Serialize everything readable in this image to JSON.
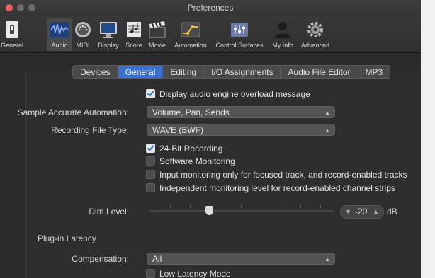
{
  "window": {
    "title": "Preferences"
  },
  "toolbar": {
    "items": [
      {
        "label": "General",
        "icon": "general-switch-icon"
      },
      {
        "label": "Audio",
        "icon": "audio-waveform-icon"
      },
      {
        "label": "MIDI",
        "icon": "midi-connector-icon"
      },
      {
        "label": "Display",
        "icon": "display-monitor-icon"
      },
      {
        "label": "Score",
        "icon": "score-notes-icon"
      },
      {
        "label": "Movie",
        "icon": "movie-clapper-icon"
      },
      {
        "label": "Automation",
        "icon": "automation-curve-icon"
      },
      {
        "label": "Control Surfaces",
        "icon": "control-surfaces-icon"
      },
      {
        "label": "My Info",
        "icon": "user-silhouette-icon"
      },
      {
        "label": "Advanced",
        "icon": "gear-icon"
      }
    ],
    "active": "Audio"
  },
  "tabs": [
    {
      "label": "Devices"
    },
    {
      "label": "General",
      "active": true
    },
    {
      "label": "Editing"
    },
    {
      "label": "I/O Assignments"
    },
    {
      "label": "Audio File Editor"
    },
    {
      "label": "MP3"
    }
  ],
  "general": {
    "overload_message": {
      "label": "Display audio engine overload message",
      "checked": true
    },
    "sample_accurate": {
      "label": "Sample Accurate Automation:",
      "value": "Volume, Pan, Sends"
    },
    "recording_file_type": {
      "label": "Recording File Type:",
      "value": "WAVE (BWF)"
    },
    "checks": [
      {
        "label": "24-Bit Recording",
        "checked": true
      },
      {
        "label": "Software Monitoring",
        "checked": false
      },
      {
        "label": "Input monitoring only for focused track, and record-enabled tracks",
        "checked": false
      },
      {
        "label": "Independent monitoring level for record-enabled channel strips",
        "checked": false
      }
    ],
    "dim_level": {
      "label": "Dim Level:",
      "value": "-20",
      "unit": "dB"
    }
  },
  "plugin_latency": {
    "section_title": "Plug-in Latency",
    "compensation": {
      "label": "Compensation:",
      "value": "All"
    },
    "low_latency": {
      "label": "Low Latency Mode",
      "checked": false
    }
  },
  "colors": {
    "accent": "#3b6fd8",
    "close": "#fc5f57",
    "background": "#2a2a2a"
  }
}
